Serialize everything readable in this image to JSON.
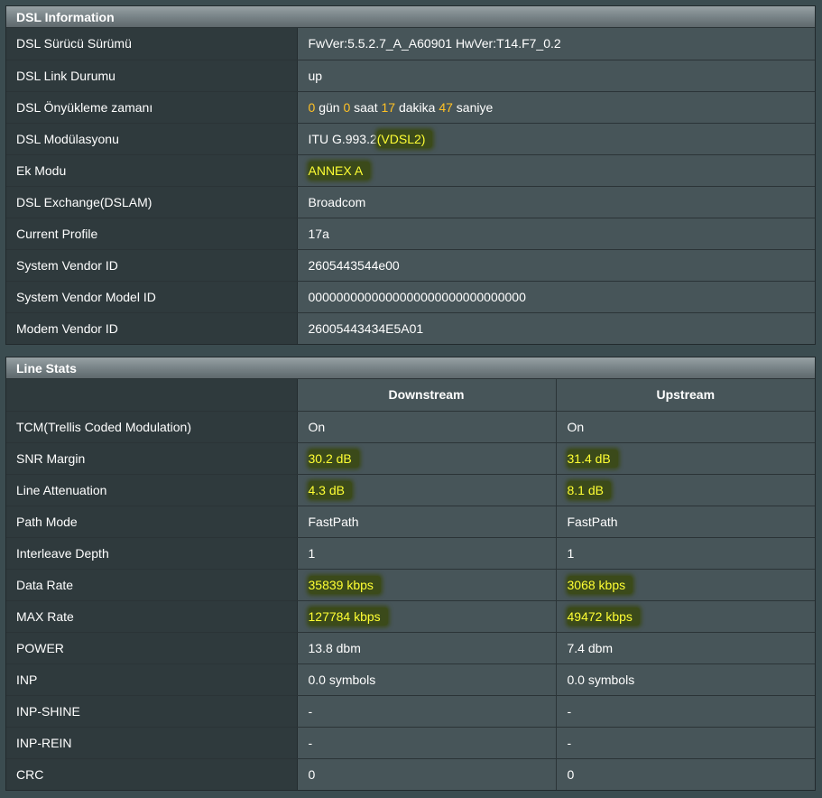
{
  "dsl_info": {
    "title": "DSL Information",
    "rows": [
      {
        "label": "DSL Sürücü Sürümü",
        "value": "FwVer:5.5.2.7_A_A60901 HwVer:T14.F7_0.2"
      },
      {
        "label": "DSL Link Durumu",
        "value": "up"
      },
      {
        "label": "DSL Önyükleme zamanı",
        "uptime": {
          "days": "0",
          "days_unit": "gün",
          "hours": "0",
          "hours_unit": "saat",
          "minutes": "17",
          "minutes_unit": "dakika",
          "seconds": "47",
          "seconds_unit": "saniye"
        }
      },
      {
        "label": "DSL Modülasyonu",
        "value_prefix": "ITU G.993.2",
        "value_highlight": "(VDSL2)"
      },
      {
        "label": "Ek Modu",
        "value_highlight": "ANNEX A"
      },
      {
        "label": "DSL Exchange(DSLAM)",
        "value": "Broadcom"
      },
      {
        "label": "Current Profile",
        "value": "17a"
      },
      {
        "label": "System Vendor ID",
        "value": "2605443544e00"
      },
      {
        "label": "System Vendor Model ID",
        "value": "0000000000000000000000000000000"
      },
      {
        "label": "Modem Vendor ID",
        "value": "26005443434E5A01"
      }
    ]
  },
  "line_stats": {
    "title": "Line Stats",
    "columns": [
      "Downstream",
      "Upstream"
    ],
    "rows": [
      {
        "label": "TCM(Trellis Coded Modulation)",
        "down": "On",
        "up": "On",
        "highlight": false
      },
      {
        "label": "SNR Margin",
        "down": "30.2 dB",
        "up": "31.4 dB",
        "highlight": true
      },
      {
        "label": "Line Attenuation",
        "down": "4.3 dB",
        "up": "8.1 dB",
        "highlight": true
      },
      {
        "label": "Path Mode",
        "down": "FastPath",
        "up": "FastPath",
        "highlight": false
      },
      {
        "label": "Interleave Depth",
        "down": "1",
        "up": "1",
        "highlight": false
      },
      {
        "label": "Data Rate",
        "down": "35839 kbps",
        "up": "3068 kbps",
        "highlight": true
      },
      {
        "label": "MAX Rate",
        "down": "127784 kbps",
        "up": "49472 kbps",
        "highlight": true
      },
      {
        "label": "POWER",
        "down": "13.8 dbm",
        "up": "7.4 dbm",
        "highlight": false
      },
      {
        "label": "INP",
        "down": "0.0 symbols",
        "up": "0.0 symbols",
        "highlight": false
      },
      {
        "label": "INP-SHINE",
        "down": "-",
        "up": "-",
        "highlight": false
      },
      {
        "label": "INP-REIN",
        "down": "-",
        "up": "-",
        "highlight": false
      },
      {
        "label": "CRC",
        "down": "0",
        "up": "0",
        "highlight": false
      }
    ]
  },
  "colors": {
    "highlight_text": "#ffff33",
    "uptime_number": "#ffc125",
    "label_bg": "#2f3a3d",
    "value_bg": "#475559"
  }
}
